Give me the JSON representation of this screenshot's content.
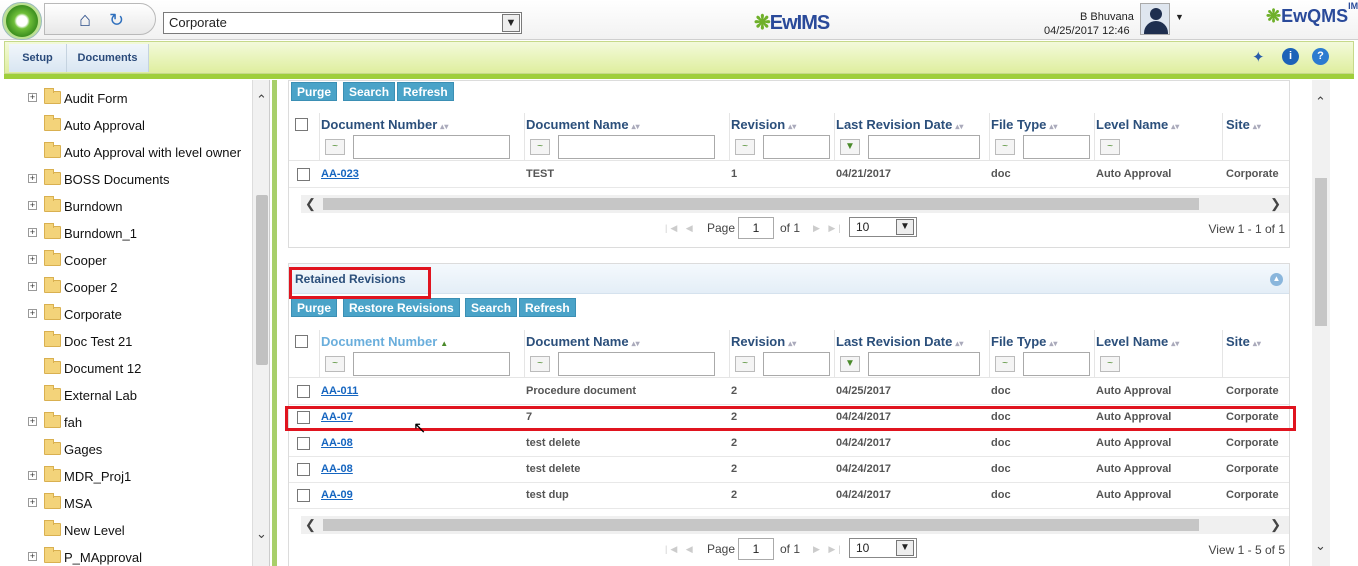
{
  "header": {
    "site_selected": "Corporate",
    "brand_center": "EwIMS",
    "brand_right": "EwQMS",
    "brand_right_sup": "IMS",
    "user_name": "B Bhuvana",
    "datetime": "04/25/2017 12:46"
  },
  "menu": {
    "setup": "Setup",
    "documents": "Documents"
  },
  "sidebar": {
    "items": [
      {
        "label": "Audit Form",
        "expandable": true
      },
      {
        "label": "Auto Approval",
        "expandable": false
      },
      {
        "label": "Auto Approval with level owner",
        "expandable": false
      },
      {
        "label": "BOSS Documents",
        "expandable": true
      },
      {
        "label": "Burndown",
        "expandable": true
      },
      {
        "label": "Burndown_1",
        "expandable": true
      },
      {
        "label": "Cooper",
        "expandable": true
      },
      {
        "label": "Cooper 2",
        "expandable": true
      },
      {
        "label": "Corporate",
        "expandable": true
      },
      {
        "label": "Doc Test 21",
        "expandable": false
      },
      {
        "label": "Document 12",
        "expandable": false
      },
      {
        "label": "External Lab",
        "expandable": false
      },
      {
        "label": "fah",
        "expandable": true
      },
      {
        "label": "Gages",
        "expandable": false
      },
      {
        "label": "MDR_Proj1",
        "expandable": true
      },
      {
        "label": "MSA",
        "expandable": true
      },
      {
        "label": "New Level",
        "expandable": false
      },
      {
        "label": "P_MApproval",
        "expandable": true
      }
    ]
  },
  "documents_grid": {
    "buttons": [
      "Purge",
      "Search",
      "Refresh"
    ],
    "columns": [
      "Document Number",
      "Document Name",
      "Revision",
      "Last Revision Date",
      "File Type",
      "Level Name",
      "Site"
    ],
    "rows": [
      [
        "AA-023",
        "TEST",
        "1",
        "04/21/2017",
        "doc",
        "Auto Approval",
        "Corporate"
      ]
    ],
    "pager": {
      "page_label": "Page",
      "page": "1",
      "of": "of 1",
      "page_size": "10",
      "view": "View 1 - 1 of 1"
    }
  },
  "retained_grid": {
    "title": "Retained Revisions",
    "buttons": [
      "Purge",
      "Restore Revisions",
      "Search",
      "Refresh"
    ],
    "columns": [
      "Document Number",
      "Document Name",
      "Revision",
      "Last Revision Date",
      "File Type",
      "Level Name",
      "Site"
    ],
    "rows": [
      [
        "AA-011",
        "Procedure document",
        "2",
        "04/25/2017",
        "doc",
        "Auto Approval",
        "Corporate"
      ],
      [
        "AA-07",
        "7",
        "2",
        "04/24/2017",
        "doc",
        "Auto Approval",
        "Corporate"
      ],
      [
        "AA-08",
        "test delete",
        "2",
        "04/24/2017",
        "doc",
        "Auto Approval",
        "Corporate"
      ],
      [
        "AA-08",
        "test delete",
        "2",
        "04/24/2017",
        "doc",
        "Auto Approval",
        "Corporate"
      ],
      [
        "AA-09",
        "test dup",
        "2",
        "04/24/2017",
        "doc",
        "Auto Approval",
        "Corporate"
      ]
    ],
    "pager": {
      "page_label": "Page",
      "page": "1",
      "of": "of 1",
      "page_size": "10",
      "view": "View 1 - 5 of 5"
    }
  },
  "colors": {
    "accent_green": "#9fcf3b",
    "button_blue": "#4aa3c8",
    "highlight_red": "#e0141f",
    "link_blue": "#1565c0"
  }
}
